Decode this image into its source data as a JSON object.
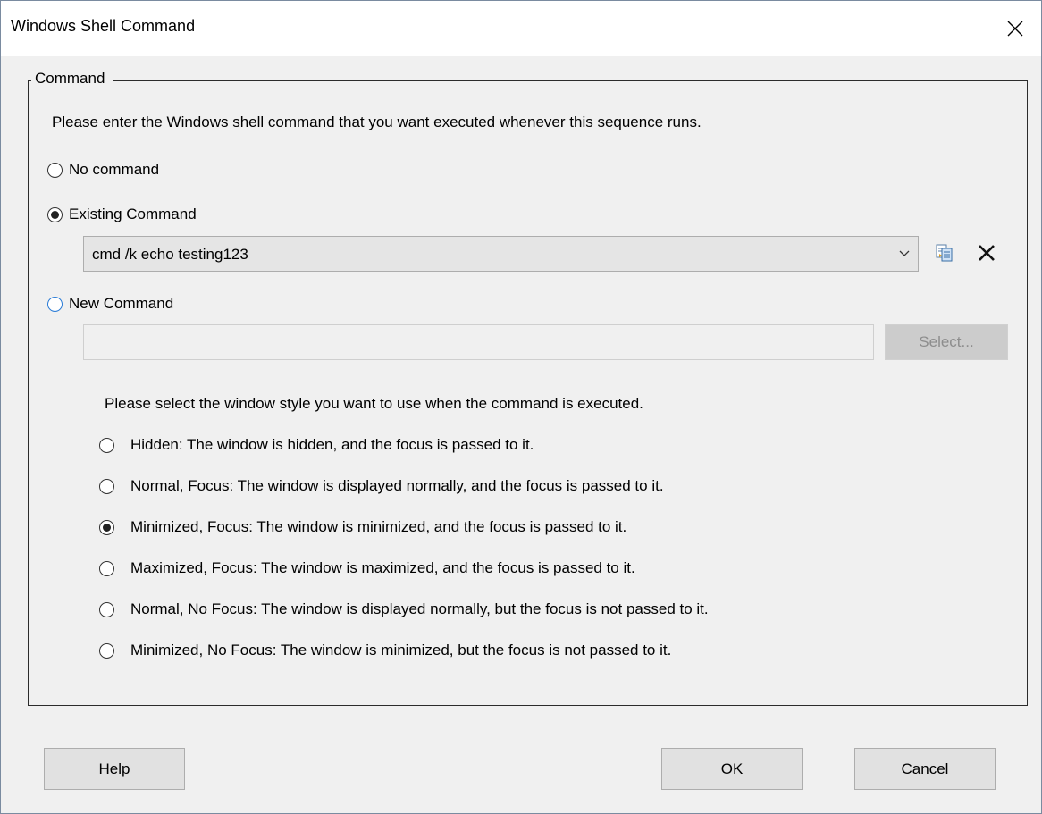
{
  "window": {
    "title": "Windows Shell Command",
    "close_glyph": "✕"
  },
  "group": {
    "legend": "Command",
    "instruction": "Please enter the Windows shell command that you want executed whenever this sequence runs."
  },
  "options": {
    "no_command": "No command",
    "existing_command": "Existing Command",
    "new_command": "New Command",
    "selected": "existing_command"
  },
  "existing": {
    "value": "cmd /k echo testing123",
    "copy_icon": "copy-icon",
    "delete_icon": "delete-x-icon"
  },
  "new_cmd": {
    "value": "",
    "select_label": "Select..."
  },
  "window_style": {
    "prompt": "Please select the window style you want to use when the command is executed.",
    "options": [
      "Hidden: The window is hidden, and the focus is passed to it.",
      "Normal, Focus: The window is displayed normally, and the focus is passed to it.",
      "Minimized, Focus: The window is minimized, and the focus is passed to it.",
      "Maximized, Focus: The window is maximized, and the focus is passed to it.",
      "Normal, No Focus: The window is displayed normally, but the focus is not passed to it.",
      "Minimized, No Focus: The window is minimized, but the focus is not passed to it."
    ],
    "selected_index": 2
  },
  "buttons": {
    "help": "Help",
    "ok": "OK",
    "cancel": "Cancel"
  },
  "colors": {
    "focus_ring": "#2a7bd6",
    "disabled_text": "#8d8d8d"
  }
}
